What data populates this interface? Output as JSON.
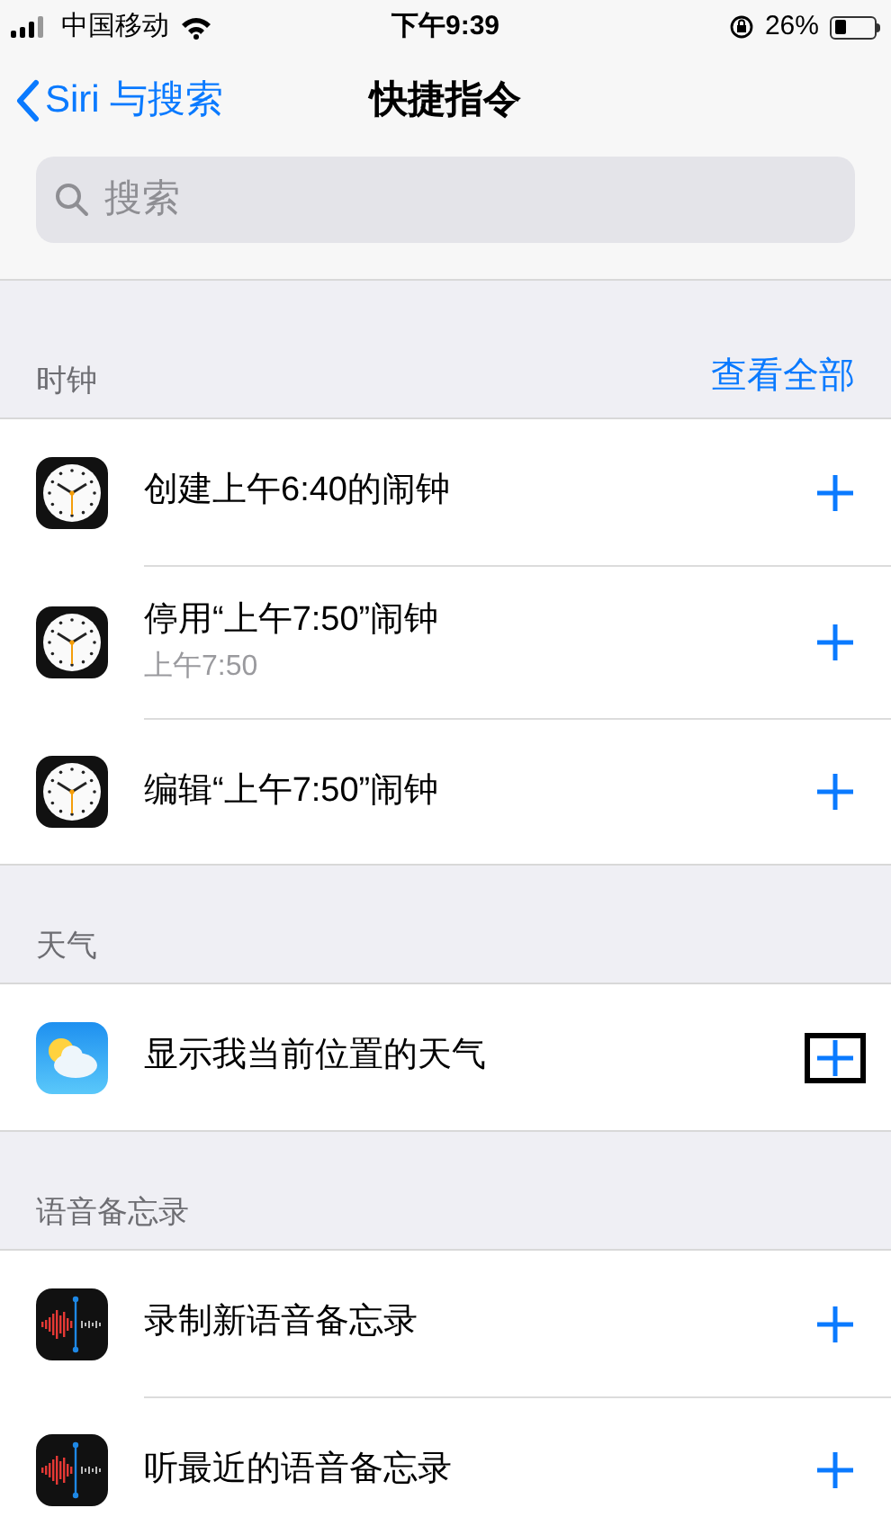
{
  "status_bar": {
    "carrier": "中国移动",
    "time": "下午9:39",
    "battery": "26%"
  },
  "nav": {
    "back": "Siri 与搜索",
    "title": "快捷指令"
  },
  "search": {
    "placeholder": "搜索"
  },
  "sections": [
    {
      "title": "时钟",
      "action": "查看全部",
      "items": [
        {
          "kind": "clock",
          "title": "创建上午6:40的闹钟",
          "focused": false
        },
        {
          "kind": "clock",
          "title": "停用“上午7:50”闹钟",
          "subtitle": "上午7:50",
          "focused": false
        },
        {
          "kind": "clock",
          "title": "编辑“上午7:50”闹钟",
          "focused": false
        }
      ]
    },
    {
      "title": "天气",
      "items": [
        {
          "kind": "weather",
          "title": "显示我当前位置的天气",
          "focused": true
        }
      ]
    },
    {
      "title": "语音备忘录",
      "items": [
        {
          "kind": "voice",
          "title": "录制新语音备忘录",
          "focused": false
        },
        {
          "kind": "voice",
          "title": "听最近的语音备忘录",
          "focused": false
        }
      ]
    }
  ]
}
